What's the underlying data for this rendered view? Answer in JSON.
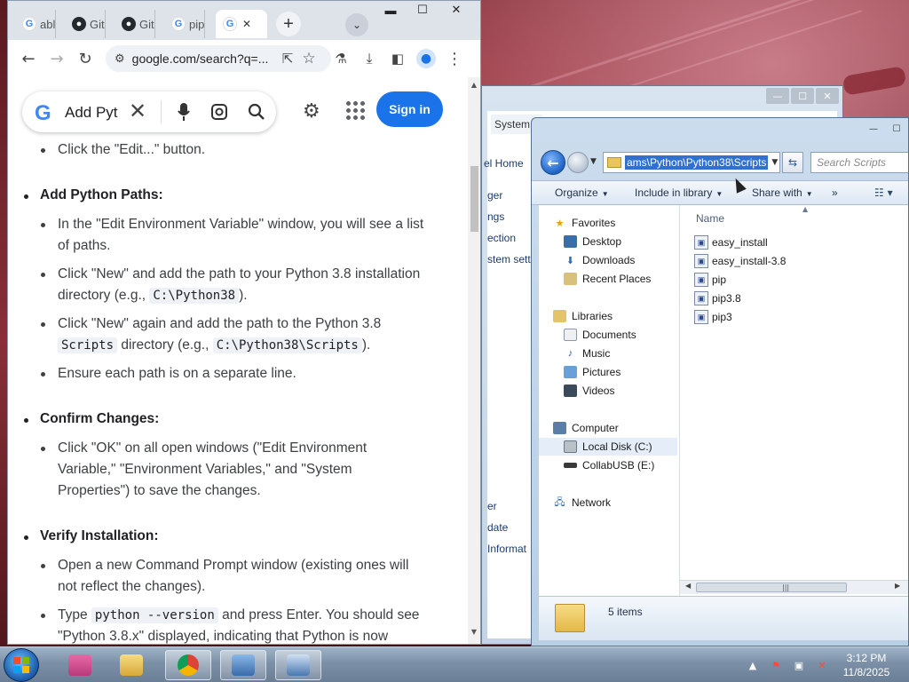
{
  "chrome": {
    "tabs": [
      {
        "label": "abl",
        "favicon": "google-icon"
      },
      {
        "label": "Git",
        "favicon": "github-icon"
      },
      {
        "label": "Git",
        "favicon": "github-icon"
      },
      {
        "label": "pip",
        "favicon": "google-icon"
      },
      {
        "label": "",
        "favicon": "google-icon",
        "active": true
      }
    ],
    "url": "google.com/search?q=...",
    "search_query": "Add Pyt",
    "sign_in_label": "Sign in"
  },
  "article": {
    "intro_item": "Click the \"Edit...\" button.",
    "sections": [
      {
        "heading": "Add Python Paths:",
        "items": [
          {
            "line1": "In the \"Edit Environment Variable\" window, you will see a list",
            "line2": "of paths."
          },
          {
            "line1": "Click \"New\" and add the path to your Python 3.8 installation",
            "line2_pre": "directory (e.g.,",
            "code": "C:\\Python38",
            "line2_post": ")."
          },
          {
            "line1": "Click \"New\" again and add the path to the Python 3.8",
            "code1": "Scripts",
            "line2_mid": "directory (e.g.,",
            "code2": "C:\\Python38\\Scripts",
            "line2_post": ")."
          },
          {
            "line1": "Ensure each path is on a separate line."
          }
        ]
      },
      {
        "heading": "Confirm Changes:",
        "items": [
          {
            "line1": "Click \"OK\" on all open windows (\"Edit Environment",
            "line2": "Variable,\" \"Environment Variables,\" and \"System",
            "line3": "Properties\") to save the changes."
          }
        ]
      },
      {
        "heading": "Verify Installation:",
        "items": [
          {
            "line1": "Open a new Command Prompt window (existing ones will",
            "line2": "not reflect the changes)."
          },
          {
            "pre": "Type",
            "code": "python --version",
            "post": "and press Enter. You should see",
            "line2": "\"Python 3.8.x\" displayed, indicating that Python is now"
          }
        ]
      }
    ]
  },
  "background_window": {
    "tab": "System",
    "side_texts": [
      "el Home",
      "ger",
      "ngs",
      "ection",
      "stem sett",
      "er",
      "date",
      "Informat"
    ]
  },
  "explorer": {
    "address_path": "ams\\Python\\Python38\\Scripts",
    "search_placeholder": "Search Scripts",
    "commands": {
      "organize": "Organize",
      "include_in_library": "Include in library",
      "share_with": "Share with",
      "more": "»"
    },
    "column_name": "Name",
    "nav": {
      "favorites": "Favorites",
      "desktop": "Desktop",
      "downloads": "Downloads",
      "recent_places": "Recent Places",
      "libraries": "Libraries",
      "documents": "Documents",
      "music": "Music",
      "pictures": "Pictures",
      "videos": "Videos",
      "computer": "Computer",
      "local_disk": "Local Disk (C:)",
      "collabusb": "CollabUSB (E:)",
      "network": "Network"
    },
    "files": [
      "easy_install",
      "easy_install-3.8",
      "pip",
      "pip3.8",
      "pip3"
    ],
    "item_count": "5 items"
  },
  "taskbar": {
    "time": "3:12 PM",
    "date": "11/8/2025"
  }
}
